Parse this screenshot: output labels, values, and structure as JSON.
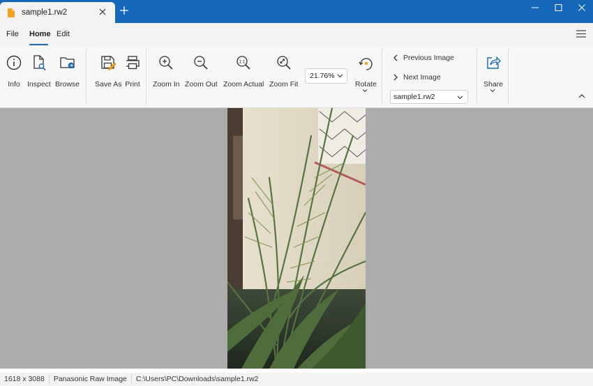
{
  "app": {
    "tab_title": "sample1.rw2",
    "accent": "#1567b8"
  },
  "window_controls": [
    "minimize-icon",
    "maximize-icon",
    "close-icon"
  ],
  "menu": {
    "items": [
      "File",
      "Home",
      "Edit"
    ],
    "active": "Home"
  },
  "ribbon": {
    "info_label": "Info",
    "inspect_label": "Inspect",
    "browse_label": "Browse",
    "save_as_label": "Save As",
    "print_label": "Print",
    "zoom_in_label": "Zoom In",
    "zoom_out_label": "Zoom Out",
    "zoom_actual_label": "Zoom Actual",
    "zoom_fit_label": "Zoom Fit",
    "zoom_value": "21.76%",
    "rotate_label": "Rotate",
    "previous_label": "Previous Image",
    "next_label": "Next Image",
    "file_value": "sample1.rw2",
    "share_label": "Share"
  },
  "image": {
    "subject": "palm-leaves-photo"
  },
  "status": {
    "dimensions": "1618 x 3088",
    "type": "Panasonic Raw Image",
    "path": "C:\\Users\\PC\\Downloads\\sample1.rw2"
  }
}
